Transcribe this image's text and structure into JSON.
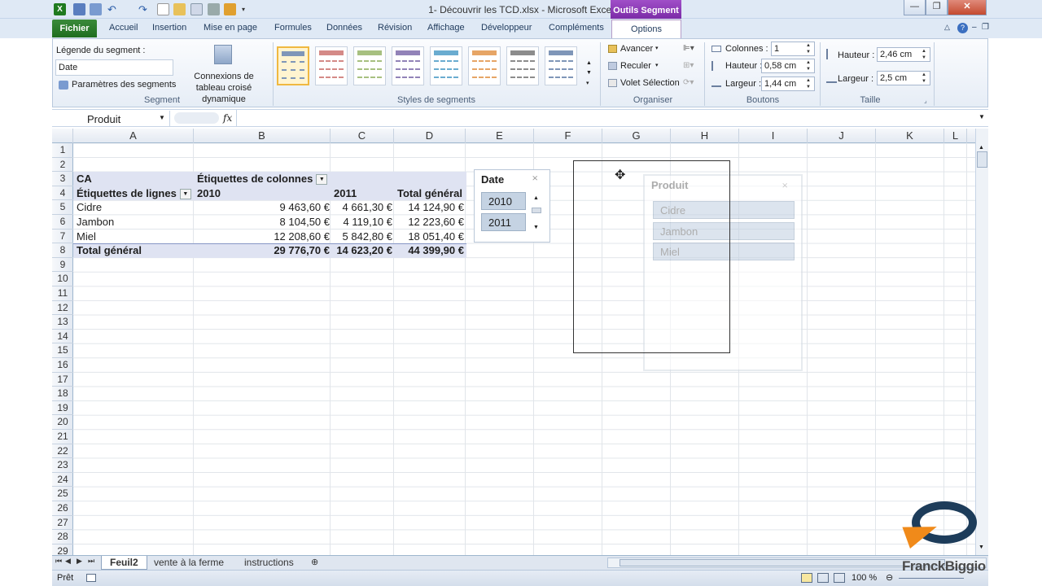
{
  "window": {
    "title": "1- Découvrir les TCD.xlsx  -  Microsoft Excel",
    "context_tab_group": "Outils Segment"
  },
  "tabs": {
    "file": "Fichier",
    "items": [
      "Accueil",
      "Insertion",
      "Mise en page",
      "Formules",
      "Données",
      "Révision",
      "Affichage",
      "Développeur",
      "Compléments"
    ],
    "active": "Options"
  },
  "ribbon": {
    "segment": {
      "caption_label": "Légende du segment :",
      "caption_value": "Date",
      "settings_button": "Paramètres des segments",
      "connections_button": "Connexions de tableau croisé dynamique",
      "group": "Segment"
    },
    "styles": {
      "group": "Styles de segments",
      "colors": [
        "#7f96b8",
        "#d48a87",
        "#a7c080",
        "#9283b8",
        "#6aacd0",
        "#e6a566",
        "#8c8c8c",
        "#7f96b8"
      ]
    },
    "arrange": {
      "forward": "Avancer",
      "backward": "Reculer",
      "selection_pane": "Volet Sélection",
      "group": "Organiser"
    },
    "buttons": {
      "columns_label": "Colonnes :",
      "columns_value": "1",
      "height_label": "Hauteur :",
      "height_value": "0,58 cm",
      "width_label": "Largeur :",
      "width_value": "1,44 cm",
      "group": "Boutons"
    },
    "size": {
      "height_label": "Hauteur :",
      "height_value": "2,46 cm",
      "width_label": "Largeur :",
      "width_value": "2,5 cm",
      "group": "Taille"
    }
  },
  "formula_bar": {
    "name_box": "Produit",
    "fx": "fx",
    "content": ""
  },
  "grid": {
    "columns": [
      "A",
      "B",
      "C",
      "D",
      "E",
      "F",
      "G",
      "H",
      "I",
      "J",
      "K",
      "L"
    ],
    "rows": [
      "1",
      "2",
      "3",
      "4",
      "5",
      "6",
      "7",
      "8",
      "9",
      "10",
      "11",
      "12",
      "13",
      "14",
      "15",
      "16",
      "17",
      "18",
      "19",
      "20",
      "21",
      "22",
      "23",
      "24",
      "25",
      "26",
      "27",
      "28",
      "29"
    ]
  },
  "pivot": {
    "value_field": "CA",
    "col_labels": "Étiquettes de colonnes",
    "row_labels": "Étiquettes de lignes",
    "headers": [
      "2010",
      "2011",
      "Total général"
    ],
    "rows": [
      {
        "label": "Cidre",
        "v2010": "9 463,60 €",
        "v2011": "4 661,30 €",
        "total": "14 124,90 €"
      },
      {
        "label": "Jambon",
        "v2010": "8 104,50 €",
        "v2011": "4 119,10 €",
        "total": "12 223,60 €"
      },
      {
        "label": "Miel",
        "v2010": "12 208,60 €",
        "v2011": "5 842,80 €",
        "total": "18 051,40 €"
      }
    ],
    "total": {
      "label": "Total général",
      "v2010": "29 776,70 €",
      "v2011": "14 623,20 €",
      "total": "44 399,90 €"
    }
  },
  "slicers": {
    "date": {
      "title": "Date",
      "items": [
        "2010",
        "2011"
      ]
    },
    "produit": {
      "title": "Produit",
      "items": [
        "Cidre",
        "Jambon",
        "Miel"
      ]
    }
  },
  "sheets": {
    "tabs": [
      "Feuil2",
      "vente à la ferme",
      "instructions"
    ],
    "active": "Feuil2"
  },
  "status": {
    "ready": "Prêt",
    "zoom": "100 %"
  },
  "watermark": "FranckBiggio"
}
